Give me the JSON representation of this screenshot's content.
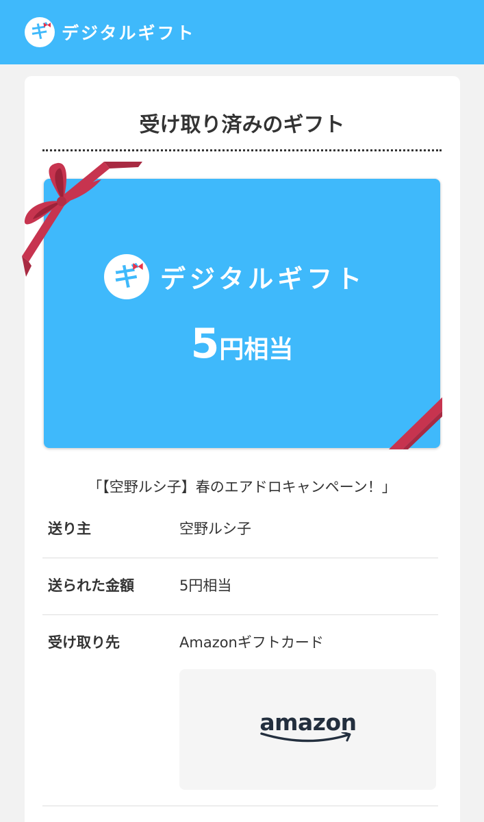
{
  "header": {
    "logo_glyph": "ギ",
    "logo_text": "デジタルギフト"
  },
  "page": {
    "title": "受け取り済みのギフト"
  },
  "gift_card": {
    "logo_glyph": "ギ",
    "logo_text": "デジタルギフト",
    "amount": "5",
    "amount_unit": "円相当"
  },
  "campaign": "「【空野ルシ子】春のエアドロキャンペーン！」",
  "details": [
    {
      "label": "送り主",
      "value": "空野ルシ子"
    },
    {
      "label": "送られた金額",
      "value": "5円相当"
    },
    {
      "label": "受け取り先",
      "value": "Amazonギフトカード"
    }
  ],
  "amazon": {
    "logo_text": "amazon"
  },
  "colors": {
    "brand_blue": "#3fb9fb",
    "ribbon_red": "#c7344f",
    "text": "#333333",
    "amazon_navy": "#232f3e",
    "amazon_orange": "#ff9900"
  }
}
